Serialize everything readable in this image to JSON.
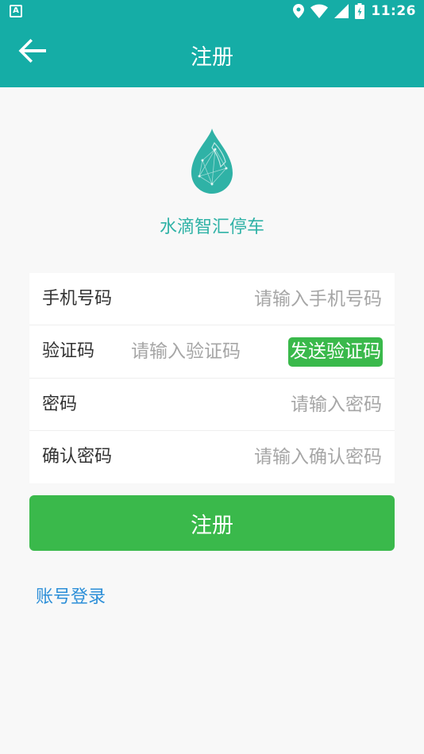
{
  "status_bar": {
    "left_icon": "A",
    "time": "11:26",
    "icons": [
      "location-icon",
      "wifi-icon",
      "signal-icon",
      "battery-icon"
    ]
  },
  "app_bar": {
    "title": "注册",
    "back_icon": "arrow-left-icon"
  },
  "brand": {
    "name": "水滴智汇停车",
    "logo_color": "#2fb2a6"
  },
  "form": {
    "phone": {
      "label": "手机号码",
      "placeholder": "请输入手机号码",
      "value": ""
    },
    "code": {
      "label": "验证码",
      "placeholder": "请输入验证码",
      "value": "",
      "send_label": "发送验证码"
    },
    "password": {
      "label": "密码",
      "placeholder": "请输入密码",
      "value": ""
    },
    "confirm": {
      "label": "确认密码",
      "placeholder": "请输入确认密码",
      "value": ""
    }
  },
  "register_label": "注册",
  "login_link": "账号登录",
  "colors": {
    "primary": "#15ada6",
    "button": "#3ab94b",
    "link": "#2d8fd8"
  }
}
